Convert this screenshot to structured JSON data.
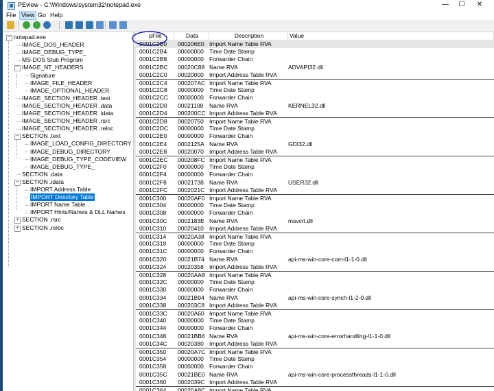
{
  "window": {
    "title": "PEview - C:\\Windows\\system32\\notepad.exe",
    "controls": {
      "minimize": "—",
      "maximize": "☐",
      "close": "✕"
    }
  },
  "menu": [
    {
      "label": "File",
      "active": false
    },
    {
      "label": "View",
      "active": true
    },
    {
      "label": "Go",
      "active": false
    },
    {
      "label": "Help",
      "active": false
    }
  ],
  "toolbar": {
    "buttons": [
      {
        "name": "open-icon",
        "color": "#e0b030"
      },
      {
        "name": "back-icon",
        "color": "#3aa63a"
      },
      {
        "name": "forward-icon",
        "color": "#3aa63a"
      },
      {
        "name": "first-icon",
        "color": "#2e75b6"
      },
      {
        "name": "prev-icon",
        "color": "#2e75b6"
      },
      {
        "name": "next-icon",
        "color": "#2e75b6"
      },
      {
        "name": "last-icon",
        "color": "#2e75b6"
      },
      {
        "name": "view-hex-icon",
        "color": "#5a8fcf"
      },
      {
        "name": "view-list-icon",
        "color": "#5a8fcf"
      },
      {
        "name": "view-detail-icon",
        "color": "#5a8fcf"
      }
    ]
  },
  "tree": [
    {
      "label": "notepad.exe",
      "level": 0,
      "expander": "⊟",
      "selected": false
    },
    {
      "label": "IMAGE_DOS_HEADER",
      "level": 1,
      "expander": "",
      "selected": false
    },
    {
      "label": "IMAGE_DEBUG_TYPE_",
      "level": 1,
      "expander": "",
      "selected": false
    },
    {
      "label": "MS-DOS Stub Program",
      "level": 1,
      "expander": "",
      "selected": false
    },
    {
      "label": "IMAGE_NT_HEADERS",
      "level": 1,
      "expander": "⊟",
      "selected": false
    },
    {
      "label": "Signature",
      "level": 2,
      "expander": "",
      "selected": false
    },
    {
      "label": "IMAGE_FILE_HEADER",
      "level": 2,
      "expander": "",
      "selected": false
    },
    {
      "label": "IMAGE_OPTIONAL_HEADER",
      "level": 2,
      "expander": "",
      "selected": false
    },
    {
      "label": "IMAGE_SECTION_HEADER .text",
      "level": 1,
      "expander": "",
      "selected": false
    },
    {
      "label": "IMAGE_SECTION_HEADER .data",
      "level": 1,
      "expander": "",
      "selected": false
    },
    {
      "label": "IMAGE_SECTION_HEADER .idata",
      "level": 1,
      "expander": "",
      "selected": false
    },
    {
      "label": "IMAGE_SECTION_HEADER .rsrc",
      "level": 1,
      "expander": "",
      "selected": false
    },
    {
      "label": "IMAGE_SECTION_HEADER .reloc",
      "level": 1,
      "expander": "",
      "selected": false
    },
    {
      "label": "SECTION .text",
      "level": 1,
      "expander": "⊟",
      "selected": false
    },
    {
      "label": "IMAGE_LOAD_CONFIG_DIRECTORY",
      "level": 2,
      "expander": "",
      "selected": false
    },
    {
      "label": "IMAGE_DEBUG_DIRECTORY",
      "level": 2,
      "expander": "",
      "selected": false
    },
    {
      "label": "IMAGE_DEBUG_TYPE_CODEVIEW",
      "level": 2,
      "expander": "",
      "selected": false
    },
    {
      "label": "IMAGE_DEBUG_TYPE_",
      "level": 2,
      "expander": "",
      "selected": false
    },
    {
      "label": "SECTION .data",
      "level": 1,
      "expander": "",
      "selected": false
    },
    {
      "label": "SECTION .idata",
      "level": 1,
      "expander": "⊟",
      "selected": false
    },
    {
      "label": "IMPORT Address Table",
      "level": 2,
      "expander": "",
      "selected": false
    },
    {
      "label": "IMPORT Directory Table",
      "level": 2,
      "expander": "",
      "selected": true
    },
    {
      "label": "IMPORT Name Table",
      "level": 2,
      "expander": "",
      "selected": false
    },
    {
      "label": "IMPORT Hints/Names & DLL Names",
      "level": 2,
      "expander": "",
      "selected": false
    },
    {
      "label": "SECTION .rsrc",
      "level": 1,
      "expander": "⊞",
      "selected": false
    },
    {
      "label": "SECTION .reloc",
      "level": 1,
      "expander": "⊞",
      "selected": false
    }
  ],
  "table": {
    "columns": [
      "pFile",
      "Data",
      "Description",
      "Value"
    ],
    "rows": [
      [
        "0001C2B0",
        "000206E0",
        "Import Name Table RVA",
        ""
      ],
      [
        "0001C2B4",
        "00000000",
        "Time Date Stamp",
        ""
      ],
      [
        "0001C2B8",
        "00000000",
        "Forwarder Chain",
        ""
      ],
      [
        "0001C2BC",
        "00020C88",
        "Name RVA",
        "ADVAPI32.dll"
      ],
      [
        "0001C2C0",
        "00020000",
        "Import Address Table RVA",
        ""
      ],
      [
        "0001C2C4",
        "000207AC",
        "Import Name Table RVA",
        ""
      ],
      [
        "0001C2C8",
        "00000000",
        "Time Date Stamp",
        ""
      ],
      [
        "0001C2CC",
        "00000000",
        "Forwarder Chain",
        ""
      ],
      [
        "0001C2D0",
        "00021108",
        "Name RVA",
        "KERNEL32.dll"
      ],
      [
        "0001C2D4",
        "000200CC",
        "Import Address Table RVA",
        ""
      ],
      [
        "0001C2D8",
        "00020750",
        "Import Name Table RVA",
        ""
      ],
      [
        "0001C2DC",
        "00000000",
        "Time Date Stamp",
        ""
      ],
      [
        "0001C2E0",
        "00000000",
        "Forwarder Chain",
        ""
      ],
      [
        "0001C2E4",
        "0002125A",
        "Name RVA",
        "GDI32.dll"
      ],
      [
        "0001C2E8",
        "00020070",
        "Import Address Table RVA",
        ""
      ],
      [
        "0001C2EC",
        "000208FC",
        "Import Name Table RVA",
        ""
      ],
      [
        "0001C2F0",
        "00000000",
        "Time Date Stamp",
        ""
      ],
      [
        "0001C2F4",
        "00000000",
        "Forwarder Chain",
        ""
      ],
      [
        "0001C2F8",
        "00021738",
        "Name RVA",
        "USER32.dll"
      ],
      [
        "0001C2FC",
        "0002021C",
        "Import Address Table RVA",
        ""
      ],
      [
        "0001C300",
        "00020AF0",
        "Import Name Table RVA",
        ""
      ],
      [
        "0001C304",
        "00000000",
        "Time Date Stamp",
        ""
      ],
      [
        "0001C308",
        "00000000",
        "Forwarder Chain",
        ""
      ],
      [
        "0001C30C",
        "0002183E",
        "Name RVA",
        "msvcrt.dll"
      ],
      [
        "0001C310",
        "00020410",
        "Import Address Table RVA",
        ""
      ],
      [
        "0001C314",
        "00020A38",
        "Import Name Table RVA",
        ""
      ],
      [
        "0001C318",
        "00000000",
        "Time Date Stamp",
        ""
      ],
      [
        "0001C31C",
        "00000000",
        "Forwarder Chain",
        ""
      ],
      [
        "0001C320",
        "00021B74",
        "Name RVA",
        "api-ms-win-core-com-l1-1-0.dll"
      ],
      [
        "0001C324",
        "00020358",
        "Import Address Table RVA",
        ""
      ],
      [
        "0001C328",
        "00020AA8",
        "Import Name Table RVA",
        ""
      ],
      [
        "0001C32C",
        "00000000",
        "Time Date Stamp",
        ""
      ],
      [
        "0001C330",
        "00000000",
        "Forwarder Chain",
        ""
      ],
      [
        "0001C334",
        "00021B94",
        "Name RVA",
        "api-ms-win-core-synch-l1-2-0.dll"
      ],
      [
        "0001C338",
        "000203C8",
        "Import Address Table RVA",
        ""
      ],
      [
        "0001C33C",
        "00020A60",
        "Import Name Table RVA",
        ""
      ],
      [
        "0001C340",
        "00000000",
        "Time Date Stamp",
        ""
      ],
      [
        "0001C344",
        "00000000",
        "Forwarder Chain",
        ""
      ],
      [
        "0001C348",
        "00021BB6",
        "Name RVA",
        "api-ms-win-core-errorhandling-l1-1-0.dll"
      ],
      [
        "0001C34C",
        "00020380",
        "Import Address Table RVA",
        ""
      ],
      [
        "0001C350",
        "00020A7C",
        "Import Name Table RVA",
        ""
      ],
      [
        "0001C354",
        "00000000",
        "Time Date Stamp",
        ""
      ],
      [
        "0001C358",
        "00000000",
        "Forwarder Chain",
        ""
      ],
      [
        "0001C35C",
        "00021BE0",
        "Name RVA",
        "api-ms-win-core-processthreads-l1-1-0.dll"
      ],
      [
        "0001C360",
        "0002039C",
        "Import Address Table RVA",
        ""
      ],
      [
        "0001C364",
        "00020A8C",
        "Import Name Table RVA",
        ""
      ]
    ],
    "selected_row": 0,
    "annotation_color": "#1c1cb0"
  }
}
